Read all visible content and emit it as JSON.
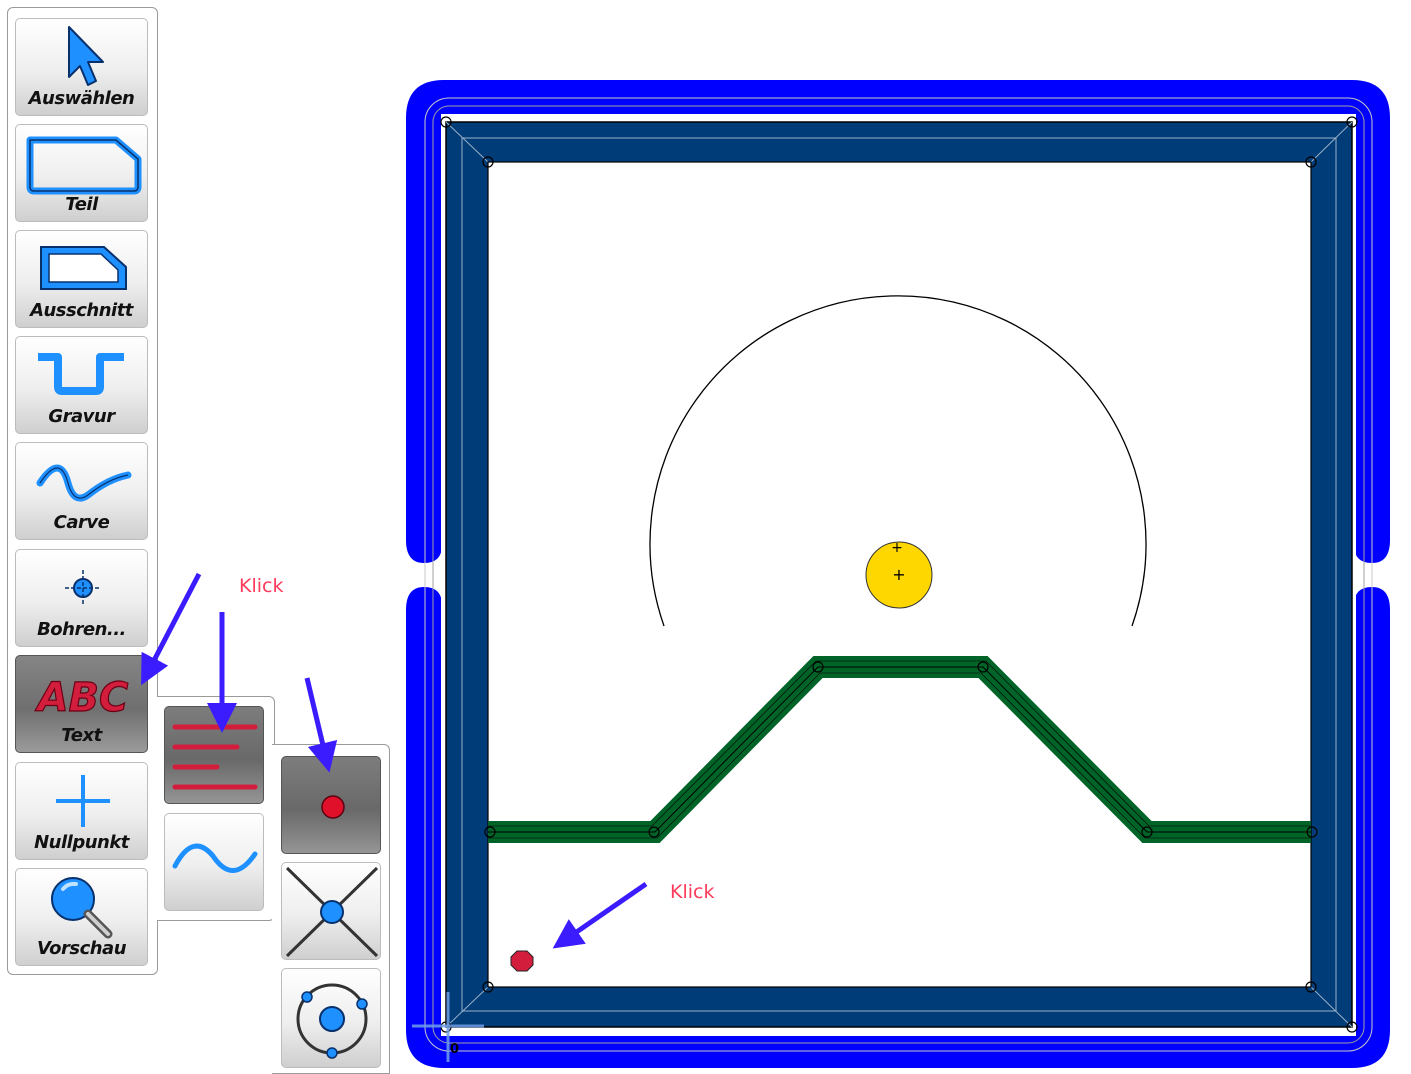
{
  "toolbar": {
    "tools": [
      {
        "label": "Auswählen",
        "icon": "arrow-cursor-icon"
      },
      {
        "label": "Teil",
        "icon": "part-outline-icon"
      },
      {
        "label": "Ausschnitt",
        "icon": "cutout-icon"
      },
      {
        "label": "Gravur",
        "icon": "engrave-icon"
      },
      {
        "label": "Carve",
        "icon": "carve-wave-icon"
      },
      {
        "label": "Bohren...",
        "icon": "drill-crosshair-icon"
      },
      {
        "label": "Text",
        "icon": "abc-text-icon",
        "active": true
      },
      {
        "label": "Nullpunkt",
        "icon": "plus-origin-icon"
      },
      {
        "label": "Vorschau",
        "icon": "magnifier-icon"
      }
    ],
    "text_icon_glyphs": "ABC"
  },
  "text_submenu": {
    "items": [
      {
        "icon": "text-lines-icon",
        "active": true
      },
      {
        "icon": "wave-text-icon",
        "active": false
      }
    ]
  },
  "align_submenu": {
    "items": [
      {
        "icon": "point-anchor-icon",
        "active": true
      },
      {
        "icon": "intersection-anchor-icon",
        "active": false
      },
      {
        "icon": "circle-anchor-icon",
        "active": false
      }
    ]
  },
  "annotations": {
    "klick_1": "Klick",
    "klick_2": "Klick"
  },
  "canvas": {
    "origin_label": "0"
  },
  "colors": {
    "outer_border": "#0000ff",
    "inner_border": "#003c78",
    "engrave_path": "#006428",
    "drill_point": "#ffd700",
    "text_point": "#d21e3c",
    "annotation_arrow": "#3a1cff",
    "annotation_text": "#ff3b5c",
    "tool_accent": "#1e90ff"
  }
}
